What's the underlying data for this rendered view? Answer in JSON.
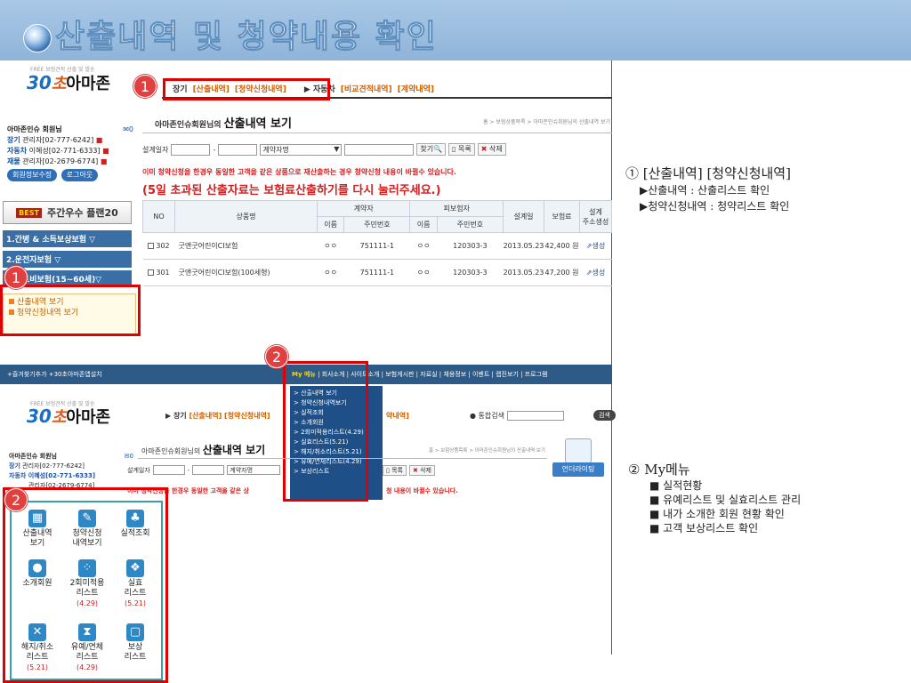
{
  "slide": {
    "title": "산출내역 및 청약내용 확인"
  },
  "logo": {
    "small": "FREE 보험견적 산출 및 발송",
    "num": "30",
    "cho": "초",
    "kr": "아마존"
  },
  "topnav": {
    "tab1_prefix": "장기",
    "tab1_a": "[산출내역]",
    "tab1_b": "[청약신청내역]",
    "tab2_prefix": "▶ 자동차",
    "tab2_a": "[비교견적내역]",
    "tab2_b": "[계약내역]"
  },
  "member": {
    "name": "아마존인슈 회원님",
    "mail": "✉0",
    "line1_label": "장기",
    "line1": "관리자[02-777-6242]",
    "line2_label": "자동차",
    "line2": "이혜성[02-771-6333]",
    "line3_label": "재물",
    "line3": "관리자[02-2679-6774]",
    "btn_edit": "회원정보수정",
    "btn_logout": "로그아웃"
  },
  "best": {
    "badge": "BEST",
    "label": "주간우수 플랜20"
  },
  "sidebar": [
    "1.간병 & 소득보상보험 ▽",
    "2.운전자보험 ▽",
    "3.의료비보험(15~60세)▽"
  ],
  "sublist": [
    "산출내역 보기",
    "청약신청내역 보기"
  ],
  "main": {
    "owner": "아마존인슈회원님의",
    "title": "산출내역 보기",
    "breadcrumb": "홈 > 보험상품목록 > 아마존인슈회원님의 산출내역 보기",
    "search_label": "설계일자",
    "select_value": "계약자명",
    "btn_find": "찾기",
    "btn_list": "목록",
    "btn_delete": "삭제",
    "warn1": "이미 청약신청을 한경우 동일한 고객을 같은 상품으로 재산출하는 경우 청약신청 내용이 바뀔수 있습니다.",
    "warn2": "(5일 초과된 산출자료는 보험료산출하기를 다시 눌러주세요.)"
  },
  "table": {
    "headers": {
      "no": "NO",
      "product": "상품명",
      "contractor": "계약자",
      "insured": "피보험자",
      "name": "이름",
      "ssn": "주민번호",
      "date": "설계일",
      "premium": "보험료",
      "design": "설계",
      "design2": "주소생성"
    },
    "rows": [
      {
        "no": "302",
        "product": "굿앤굿어린이CI보험",
        "c_name": "ㅇㅇ",
        "c_ssn": "751111-1",
        "i_name": "ㅇㅇ",
        "i_ssn": "120303-3",
        "date": "2013.05.23",
        "premium": "42,400 원",
        "action": "생성"
      },
      {
        "no": "301",
        "product": "굿앤굿어린이CI보험(100세형)",
        "c_name": "ㅇㅇ",
        "c_ssn": "751111-1",
        "i_name": "ㅇㅇ",
        "i_ssn": "120303-3",
        "date": "2013.05.23",
        "premium": "47,200 원",
        "action": "생성"
      }
    ]
  },
  "topbar2": {
    "left": "+즐겨찾기추가   +30초아마존앱설치",
    "my": "My 메뉴",
    "rest": " | 회사소개 | 사이트소개 | 보험게시판 | 자료실 | 채용정보 | 이벤트 | 랩진보기 | 프로그램"
  },
  "dropdown": [
    "> 산출내역 보기",
    "> 청약신청내역보기",
    "> 실적조회",
    "> 소개회원",
    "> 2회미적용리스트(4.29)",
    "> 실효리스트(5.21)",
    "> 해지/취소리스트(5.21)",
    "> 유예/연체리스트(4.29)",
    "> 보상리스트"
  ],
  "screen2": {
    "nav": "▶ 장기",
    "nav_a": "[산출내역]",
    "nav_b": "[청약신청내역]",
    "nav_tail": "약내역]",
    "total_search": "● 통합검색",
    "search_btn": "검색",
    "member_line2": "자동차 이혜성[02-771-6333]",
    "member_line3": "관리자[02-2679-6774]",
    "owner": "아마존인슈회원님의",
    "title": "산출내역 보기",
    "breadcrumb": "홈 > 보험상품목록 > 아마존인슈회원님의 산출내역 보기",
    "search_label": "설계일자",
    "select_value": "계약자명",
    "warn": "이미 청약신청을 한경우 동일한 고객을 같은 상",
    "warn_tail": "청 내용이 바뀔수 있습니다.",
    "underwriting": "언더라이팅"
  },
  "icons": [
    {
      "label1": "산출내역",
      "label2": "보기",
      "date": "",
      "sym": "▦"
    },
    {
      "label1": "청약신청",
      "label2": "내역보기",
      "date": "",
      "sym": "✎"
    },
    {
      "label1": "실적조회",
      "label2": "",
      "date": "",
      "sym": "♣"
    },
    {
      "label1": "소개회원",
      "label2": "",
      "date": "",
      "sym": "●"
    },
    {
      "label1": "2회미적용",
      "label2": "리스트",
      "date": "(4.29)",
      "sym": "⁘"
    },
    {
      "label1": "실효",
      "label2": "리스트",
      "date": "(5.21)",
      "sym": "❖"
    },
    {
      "label1": "해지/취소",
      "label2": "리스트",
      "date": "(5.21)",
      "sym": "✕"
    },
    {
      "label1": "유예/연체",
      "label2": "리스트",
      "date": "(4.29)",
      "sym": "⧗"
    },
    {
      "label1": "보상",
      "label2": "리스트",
      "date": "",
      "sym": "▢"
    }
  ],
  "badges": {
    "one": "1",
    "two": "2"
  },
  "notes": {
    "n1_title": "① [산출내역] [청약신청내역]",
    "n1_items": [
      "▶산출내역 : 산출리스트 확인",
      "▶청약신청내역 : 청약리스트 확인"
    ],
    "n2_title": "② My메뉴",
    "n2_items": [
      "■ 실적현황",
      "■ 유예리스트 및 실효리스트 관리",
      "■ 내가 소개한 회원 현황 확인",
      "■ 고객 보상리스트 확인"
    ]
  },
  "colors": {
    "title_bar": "#a9c8e6",
    "highlight_red": "#e00000",
    "nav_blue": "#3a6fa6",
    "accent_orange": "#d06000"
  }
}
